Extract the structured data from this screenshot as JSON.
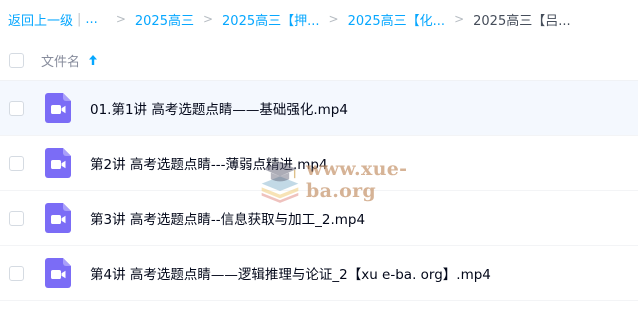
{
  "breadcrumb": {
    "back_label": "返回上一级",
    "separator": "|",
    "ellipsis": "...",
    "chevron": ">",
    "items": [
      {
        "label": "2025高三"
      },
      {
        "label": "2025高三【押..."
      },
      {
        "label": "2025高三【化..."
      }
    ],
    "current": "2025高三【吕..."
  },
  "header": {
    "column_label": "文件名",
    "sort_direction": "ascending"
  },
  "files": [
    {
      "name": "01.第1讲 高考选题点睛——基础强化.mp4",
      "type": "video",
      "selected": true
    },
    {
      "name": "第2讲 高考选题点睛---薄弱点精进.mp4",
      "type": "video",
      "selected": false
    },
    {
      "name": "第3讲 高考选题点睛--信息获取与加工_2.mp4",
      "type": "video",
      "selected": false
    },
    {
      "name": "第4讲 高考选题点睛——逻辑推理与论证_2【xu e-ba. org】.mp4",
      "type": "video",
      "selected": false
    }
  ],
  "watermark": {
    "text": "www.xue-ba.org",
    "icon": "graduation-cap-book-icon"
  },
  "colors": {
    "accent": "#06a7ff",
    "video_icon": "#7b6cf6",
    "selected_row": "#f4f8fe",
    "text": "#03081a",
    "muted": "#878c9c"
  }
}
